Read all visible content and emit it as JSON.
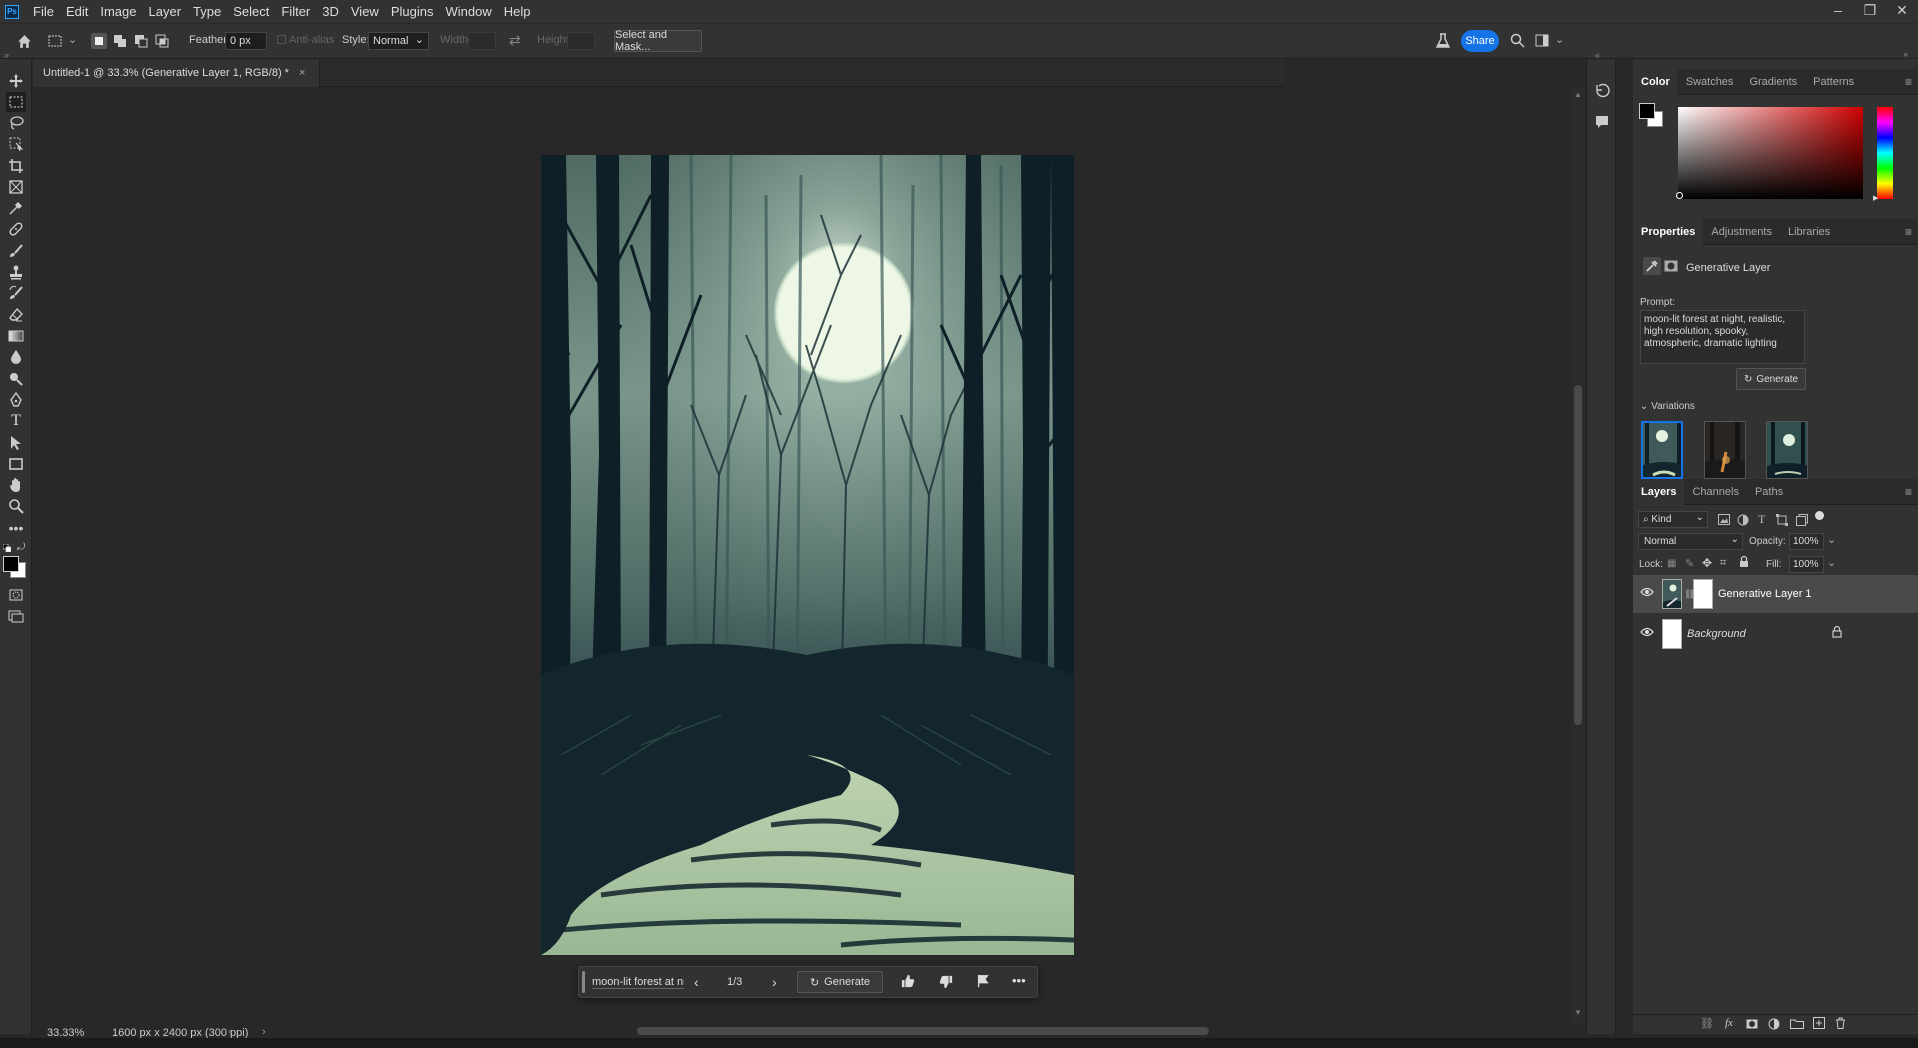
{
  "app": {
    "logo": "Ps"
  },
  "menu": [
    "File",
    "Edit",
    "Image",
    "Layer",
    "Type",
    "Select",
    "Filter",
    "3D",
    "View",
    "Plugins",
    "Window",
    "Help"
  ],
  "options": {
    "feather_label": "Feather:",
    "feather_value": "0 px",
    "antialias_label": "Anti-alias",
    "style_label": "Style:",
    "style_value": "Normal",
    "width_label": "Width:",
    "height_label": "Height:",
    "select_mask_label": "Select and Mask...",
    "share_label": "Share"
  },
  "document": {
    "tab_title": "Untitled-1 @ 33.3% (Generative Layer 1, RGB/8) *",
    "close": "×"
  },
  "contextual_taskbar": {
    "prompt_snippet": "moon-lit forest at nig",
    "page": "1/3",
    "generate_label": "Generate"
  },
  "status": {
    "zoom": "33.33%",
    "doc_info": "1600 px x 2400 px (300 ppi)"
  },
  "color_panel": {
    "tabs": [
      "Color",
      "Swatches",
      "Gradients",
      "Patterns"
    ],
    "active": "Color",
    "foreground": "#000000",
    "background": "#ffffff",
    "hue_color": "#cc0000"
  },
  "properties_panel": {
    "tabs": [
      "Properties",
      "Adjustments",
      "Libraries"
    ],
    "active": "Properties",
    "layer_type": "Generative Layer",
    "prompt_label": "Prompt:",
    "prompt_text": "moon-lit forest at night, realistic, high resolution, spooky, atmospheric, dramatic lighting",
    "generate_label": "Generate",
    "variations_label": "Variations"
  },
  "layers_panel": {
    "tabs": [
      "Layers",
      "Channels",
      "Paths"
    ],
    "active": "Layers",
    "filter_kind": "Kind",
    "blend_mode": "Normal",
    "opacity_label": "Opacity:",
    "opacity_value": "100%",
    "lock_label": "Lock:",
    "fill_label": "Fill:",
    "fill_value": "100%",
    "layers": [
      {
        "name": "Generative Layer 1",
        "visible": true,
        "selected": true
      },
      {
        "name": "Background",
        "visible": true,
        "locked": true
      }
    ]
  }
}
